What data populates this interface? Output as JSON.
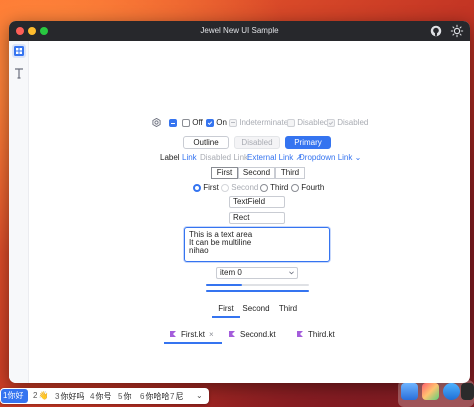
{
  "window": {
    "title": "Jewel New UI Sample"
  },
  "checkboxes": [
    {
      "label": "Off",
      "checked": false,
      "disabled": false
    },
    {
      "label": "On",
      "checked": true,
      "disabled": false
    },
    {
      "label": "Indeterminate",
      "checked": "indeterminate",
      "disabled": true
    },
    {
      "label": "Disabled",
      "checked": false,
      "disabled": true
    },
    {
      "label": "Disabled",
      "checked": true,
      "disabled": true
    }
  ],
  "buttons": {
    "outline": "Outline",
    "disabled": "Disabled",
    "primary": "Primary"
  },
  "links": {
    "label": "Label",
    "link": "Link",
    "disabled_link": "Disabled Link",
    "external_link": "External Link",
    "external_arrow": "↗",
    "dropdown_link": "Dropdown Link",
    "dropdown_chevron": "⌄"
  },
  "segmented": [
    "First",
    "Second",
    "Third"
  ],
  "radios": [
    {
      "label": "First",
      "selected": true,
      "disabled": false
    },
    {
      "label": "Second",
      "selected": false,
      "disabled": true
    },
    {
      "label": "Third",
      "selected": false,
      "disabled": false
    },
    {
      "label": "Fourth",
      "selected": false,
      "disabled": false
    }
  ],
  "fields": {
    "textfield": "TextField",
    "rect": "Rect"
  },
  "textarea": {
    "line1": "This is a text area",
    "line2": "It can be multiline",
    "line3": "nihao"
  },
  "dropdown": {
    "value": "item 0"
  },
  "progress": {
    "bar1": 0.35,
    "bar2": 1.0
  },
  "tabs": {
    "items": [
      "First",
      "Second",
      "Third"
    ],
    "selected_index": 0
  },
  "editor_tabs": {
    "items": [
      "First.kt",
      "Second.kt",
      "Third.kt"
    ],
    "close": "×",
    "selected_index": 0
  },
  "ime": {
    "candidates": [
      {
        "num": "1",
        "text": "你好"
      },
      {
        "num": "2",
        "text": "👋"
      },
      {
        "num": "3",
        "text": "你好吗"
      },
      {
        "num": "4",
        "text": "你号"
      },
      {
        "num": "5",
        "text": "你"
      },
      {
        "num": "6",
        "text": "你哈哈"
      },
      {
        "num": "7",
        "text": "尼"
      }
    ],
    "expand": "⌄"
  },
  "colors": {
    "accent": "#3574f0",
    "titlebar": "#27282c",
    "kotlin": "#a45ddb"
  }
}
